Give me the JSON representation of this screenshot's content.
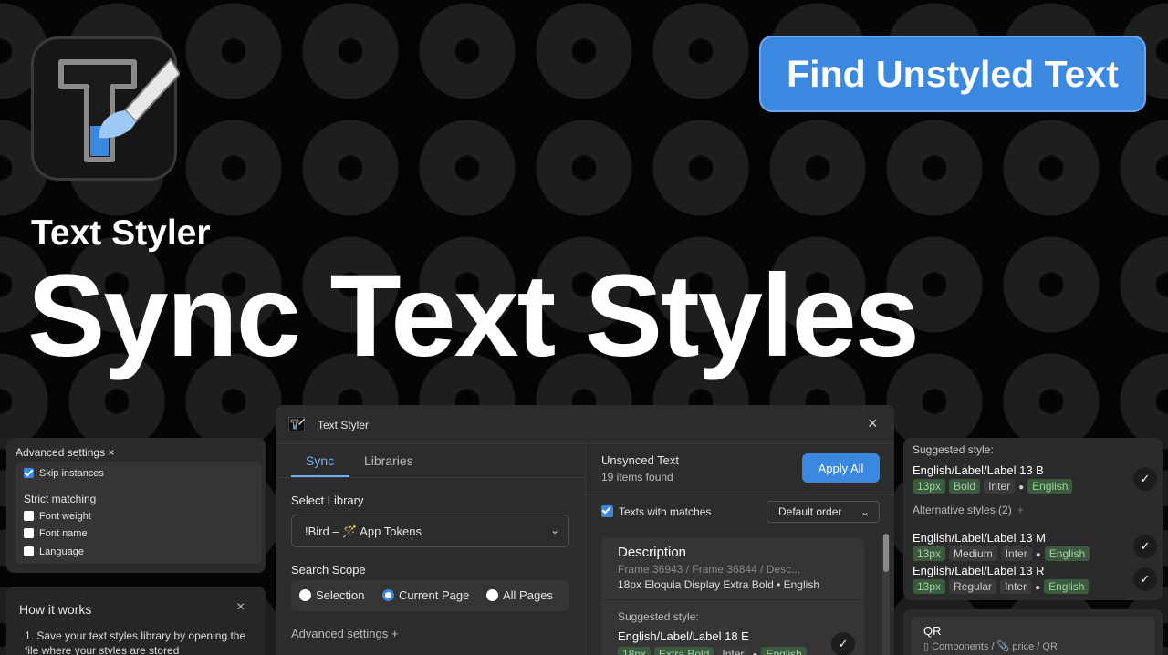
{
  "promo": {
    "find_button": "Find Unstyled Text",
    "brand": "Text Styler",
    "headline": "Sync Text Styles"
  },
  "advanced_panel": {
    "title": "Advanced settings ×",
    "skip_instances": "Skip instances",
    "strict_title": "Strict matching",
    "font_weight": "Font weight",
    "font_name": "Font name",
    "language": "Language"
  },
  "how_panel": {
    "title": "How it works",
    "close": "×",
    "text": "1. Save your text styles library by opening the file where your styles are stored"
  },
  "dialog": {
    "title": "Text Styler",
    "close": "×",
    "tabs": [
      "Sync",
      "Libraries"
    ],
    "select_library_label": "Select Library",
    "library_value": "!Bird – 🪄 App Tokens",
    "search_scope_label": "Search Scope",
    "scope_options": [
      "Selection",
      "Current Page",
      "All Pages"
    ],
    "scope_selected": "Current Page",
    "advanced_settings": "Advanced settings +",
    "unsynced_title": "Unsynced Text",
    "items_found": "19 items found",
    "apply_all": "Apply All",
    "texts_with_matches": "Texts with matches",
    "order_value": "Default order",
    "card": {
      "name": "Description",
      "path": "Frame 36943 / Frame 36844 / Desc...",
      "font": "18px Eloquia Display Extra Bold • English",
      "suggested_label": "Suggested style:",
      "suggested_name": "English/Label/Label 18 E",
      "tags": [
        "18px",
        "Extra Bold",
        "Inter",
        "English"
      ]
    }
  },
  "suggestions_panel": {
    "suggested_label": "Suggested style:",
    "suggested_name": "English/Label/Label 13 B",
    "suggested_tags": [
      "13px",
      "Bold",
      "Inter",
      "English"
    ],
    "alternative_label": "Alternative styles (2)",
    "alt1_name": "English/Label/Label 13 M",
    "alt1_tags": [
      "13px",
      "Medium",
      "Inter",
      "English"
    ],
    "alt2_name": "English/Label/Label 13 R",
    "alt2_tags": [
      "13px",
      "Regular",
      "Inter",
      "English"
    ]
  },
  "qr_panel": {
    "name": "QR",
    "path": "Components / 📎 price / QR"
  },
  "colors": {
    "accent": "#3b88e0",
    "tag_green_bg": "#3b5a3e",
    "tag_green_text": "#9fd3a4"
  }
}
